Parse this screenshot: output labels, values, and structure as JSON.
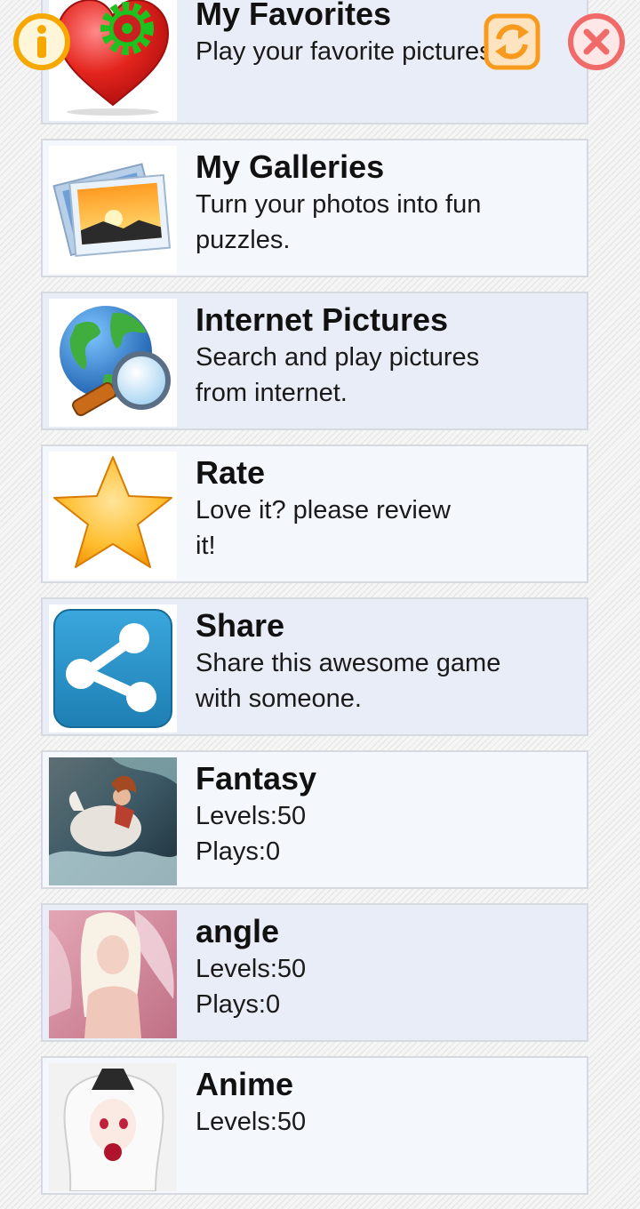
{
  "menu": [
    {
      "title": "My Favorites",
      "lines": [
        "Play your favorite pictures."
      ],
      "icon": "heart-gear-icon"
    },
    {
      "title": "My Galleries",
      "lines": [
        "Turn your photos into fun",
        "puzzles."
      ],
      "icon": "photo-gallery-icon"
    },
    {
      "title": "Internet Pictures",
      "lines": [
        "Search and play pictures",
        "from internet."
      ],
      "icon": "globe-search-icon"
    },
    {
      "title": "Rate",
      "lines": [
        "Love it? please review",
        "it!"
      ],
      "icon": "star-icon"
    },
    {
      "title": "Share",
      "lines": [
        "Share this awesome game",
        "with someone."
      ],
      "icon": "share-icon"
    }
  ],
  "puzzles": [
    {
      "title": "Fantasy",
      "levels": "Levels:50",
      "plays": "Plays:0",
      "thumb": "fantasy-thumbnail"
    },
    {
      "title": "angle",
      "levels": "Levels:50",
      "plays": "Plays:0",
      "thumb": "angel-thumbnail"
    },
    {
      "title": "Anime",
      "levels": "Levels:50",
      "plays": "",
      "thumb": "anime-thumbnail"
    }
  ],
  "top_buttons": {
    "info": "info-icon",
    "refresh": "refresh-icon",
    "close": "close-icon"
  },
  "colors": {
    "row_light": "#f4f7fc",
    "row_alt": "#e9edf7",
    "row_border": "#d6dae0",
    "info_orange": "#f7a800",
    "refresh_orange": "#f79a1e",
    "close_red": "#f06a6a"
  }
}
